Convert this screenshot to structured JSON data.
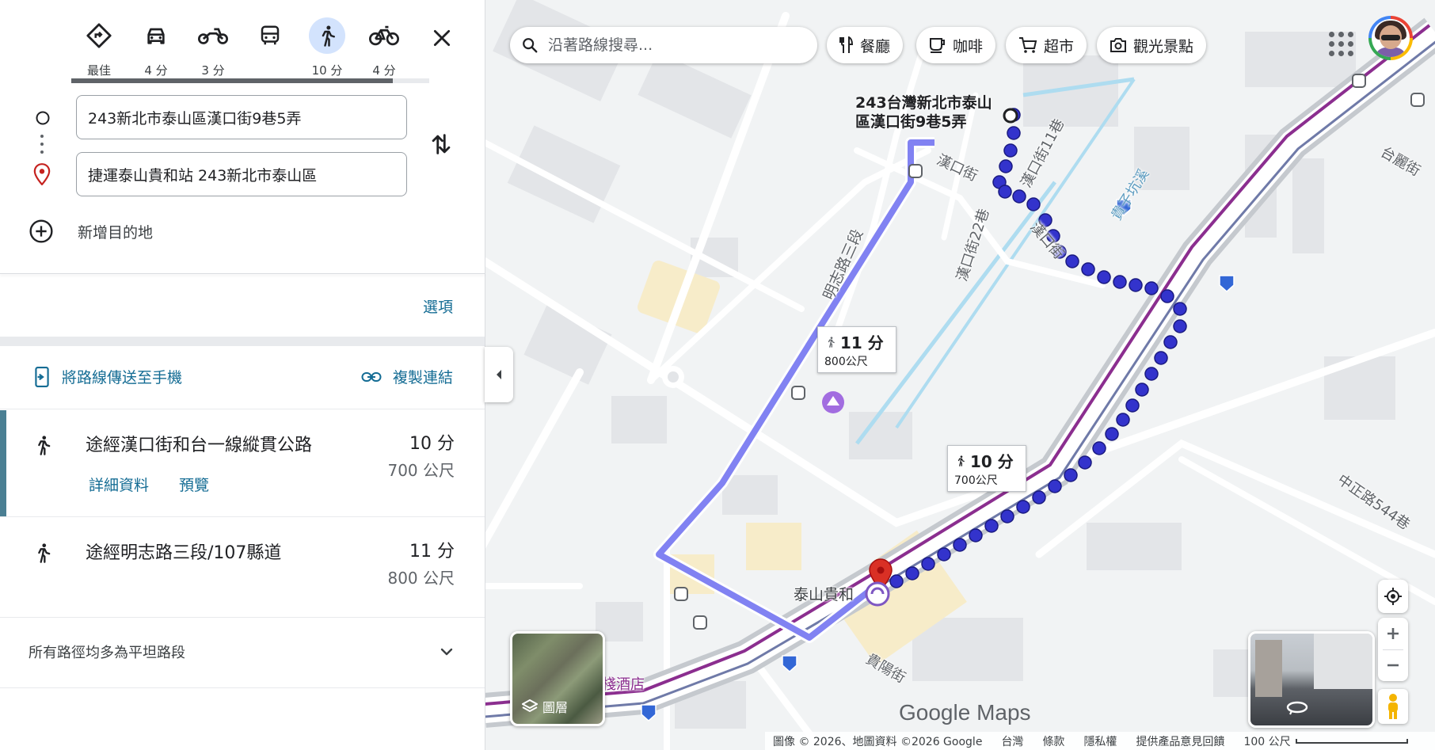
{
  "travel_modes": [
    {
      "icon": "directions-icon",
      "label": "最佳",
      "active": false
    },
    {
      "icon": "car-icon",
      "label": "4 分",
      "active": false
    },
    {
      "icon": "motorcycle-icon",
      "label": "3 分",
      "active": false
    },
    {
      "icon": "transit-icon",
      "label": "",
      "active": false
    },
    {
      "icon": "walk-icon",
      "label": "10 分",
      "active": true
    },
    {
      "icon": "bicycle-icon",
      "label": "4 分",
      "active": false
    }
  ],
  "origin": "243新北市泰山區漢口街9巷5弄",
  "destination": "捷運泰山貴和站 243新北市泰山區",
  "add_destination": "新增目的地",
  "options_label": "選項",
  "send_to_phone": "將路線傳送至手機",
  "copy_link": "複製連結",
  "routes": [
    {
      "title": "途經漢口街和台一線縱貫公路",
      "time": "10 分",
      "distance": "700 公尺",
      "details": "詳細資料",
      "preview": "預覽",
      "selected": true
    },
    {
      "title": "途經明志路三段/107縣道",
      "time": "11 分",
      "distance": "800 公尺",
      "selected": false
    }
  ],
  "flat_note": "所有路徑均多為平坦路段",
  "map": {
    "search_placeholder": "沿著路線搜尋...",
    "chips": [
      {
        "icon": "restaurant-icon",
        "label": "餐廳"
      },
      {
        "icon": "coffee-icon",
        "label": "咖啡"
      },
      {
        "icon": "cart-icon",
        "label": "超市"
      },
      {
        "icon": "camera-icon",
        "label": "觀光景點"
      }
    ],
    "origin_label": "243台灣新北市泰山區漢口街9巷5弄",
    "station_label": "泰山貴和",
    "hotel_label": "棧酒店",
    "tip_selected": {
      "time": "10 分",
      "distance": "700公尺"
    },
    "tip_alt": {
      "time": "11 分",
      "distance": "800公尺"
    },
    "streets": [
      "漢口街",
      "漢口街11巷",
      "漢口街22巷",
      "漢口街",
      "明志路三段",
      "貴子坑溪",
      "台麗街",
      "中正路544巷",
      "貴陽街"
    ],
    "route_shields": [
      "1"
    ],
    "layers_label": "圖層",
    "logo": "Google Maps",
    "footer": {
      "attribution": "圖像 © 2026、地圖資料 ©2026 Google",
      "region": "台灣",
      "terms": "條款",
      "privacy": "隱私權",
      "feedback": "提供產品意見回饋",
      "scale": "100 公尺"
    },
    "route_color_selected": "#3333cc",
    "route_color_alt": "#6b6cf0"
  }
}
